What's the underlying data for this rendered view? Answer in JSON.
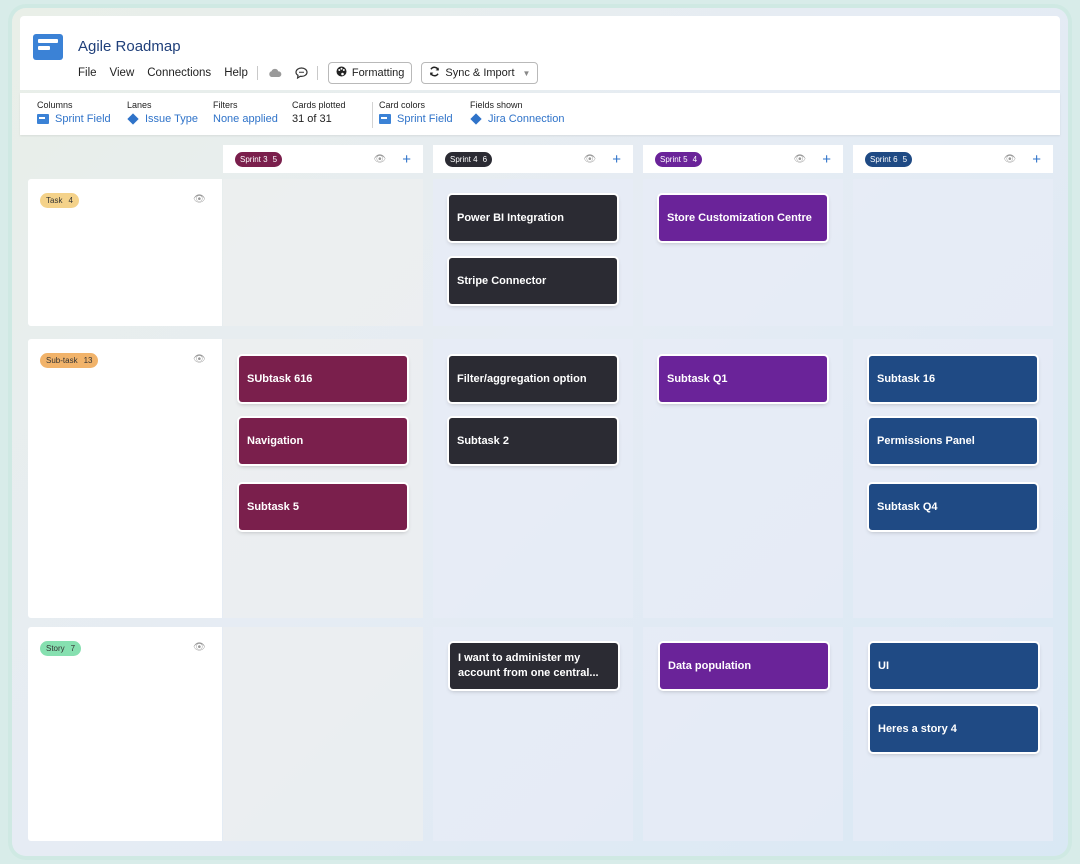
{
  "app": {
    "title": "Agile Roadmap"
  },
  "menu": {
    "file": "File",
    "view": "View",
    "connections": "Connections",
    "help": "Help"
  },
  "toolbar": {
    "formatting_label": "Formatting",
    "sync_label": "Sync & Import",
    "cloud_icon": "cloud-icon",
    "comment_icon": "comment-icon"
  },
  "config": {
    "columns": {
      "label": "Columns",
      "value": "Sprint Field"
    },
    "lanes": {
      "label": "Lanes",
      "value": "Issue Type"
    },
    "filters": {
      "label": "Filters",
      "value": "None applied"
    },
    "cards_plotted": {
      "label": "Cards plotted",
      "value": "31 of 31"
    },
    "card_colors": {
      "label": "Card colors",
      "value": "Sprint Field"
    },
    "fields_shown": {
      "label": "Fields shown",
      "value": "Jira Connection"
    }
  },
  "columns": [
    {
      "name": "Sprint 3",
      "count": "5",
      "color": "#7a1f4c"
    },
    {
      "name": "Sprint 4",
      "count": "6",
      "color": "#2b2b33"
    },
    {
      "name": "Sprint 5",
      "count": "4",
      "color": "#6a2399"
    },
    {
      "name": "Sprint 6",
      "count": "5",
      "color": "#1f4a84"
    }
  ],
  "lanes": [
    {
      "name": "Task",
      "count": "4",
      "color": "#f4d28a"
    },
    {
      "name": "Sub-task",
      "count": "13",
      "color": "#f1b36a"
    },
    {
      "name": "Story",
      "count": "7",
      "color": "#86e0b0"
    }
  ],
  "cards": {
    "task": [
      [],
      [
        "Power BI Integration",
        "Stripe Connector"
      ],
      [
        "Store Customization Centre"
      ],
      []
    ],
    "subtask": [
      [
        "SUbtask 616",
        "Navigation",
        "Subtask 5"
      ],
      [
        "Filter/aggregation option",
        "Subtask 2"
      ],
      [
        "Subtask Q1"
      ],
      [
        "Subtask 16",
        "Permissions Panel",
        "Subtask Q4"
      ]
    ],
    "story": [
      [],
      [
        "I want to administer my account from one central..."
      ],
      [
        "Data population"
      ],
      [
        "UI",
        "Heres a story 4"
      ]
    ]
  }
}
